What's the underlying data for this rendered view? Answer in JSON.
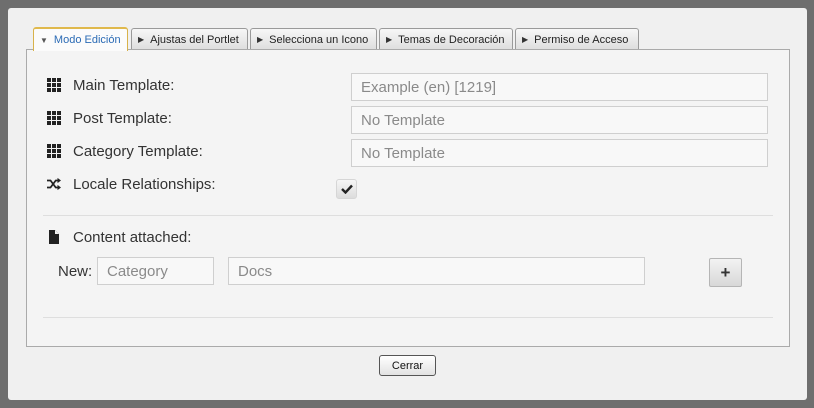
{
  "tabs": [
    {
      "label": "Modo Edición",
      "active": true
    },
    {
      "label": "Ajustas del Portlet",
      "active": false
    },
    {
      "label": "Selecciona un Icono",
      "active": false
    },
    {
      "label": "Temas de Decoración",
      "active": false
    },
    {
      "label": "Permiso de Acceso",
      "active": false
    }
  ],
  "settings": {
    "main_template": {
      "label": "Main Template:",
      "value": "Example (en) [1219]",
      "icon": "grid-icon"
    },
    "post_template": {
      "label": "Post Template:",
      "value": "No Template",
      "icon": "grid-icon"
    },
    "category_template": {
      "label": "Category Template:",
      "value": "No Template",
      "icon": "grid-icon"
    },
    "locale_relationships": {
      "label": "Locale Relationships:",
      "checked": true,
      "icon": "shuffle-icon"
    }
  },
  "content": {
    "label": "Content attached:",
    "icon": "document-icon",
    "new_label": "New:",
    "category_placeholder": "Category",
    "docs_placeholder": "Docs",
    "add_label": "+"
  },
  "footer": {
    "close_label": "Cerrar"
  },
  "colors": {
    "accent_tab_text": "#2b6bb5",
    "accent_tab_border": "#e0b94c"
  }
}
